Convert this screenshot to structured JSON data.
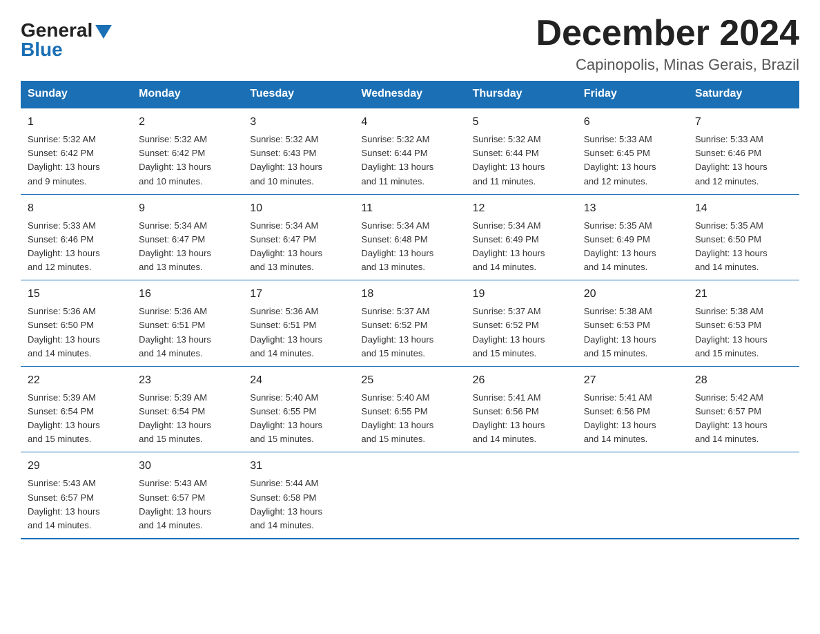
{
  "logo": {
    "general": "General",
    "blue": "Blue"
  },
  "title": "December 2024",
  "subtitle": "Capinopolis, Minas Gerais, Brazil",
  "days_of_week": [
    "Sunday",
    "Monday",
    "Tuesday",
    "Wednesday",
    "Thursday",
    "Friday",
    "Saturday"
  ],
  "weeks": [
    [
      {
        "day": "1",
        "sunrise": "5:32 AM",
        "sunset": "6:42 PM",
        "daylight": "13 hours and 9 minutes."
      },
      {
        "day": "2",
        "sunrise": "5:32 AM",
        "sunset": "6:42 PM",
        "daylight": "13 hours and 10 minutes."
      },
      {
        "day": "3",
        "sunrise": "5:32 AM",
        "sunset": "6:43 PM",
        "daylight": "13 hours and 10 minutes."
      },
      {
        "day": "4",
        "sunrise": "5:32 AM",
        "sunset": "6:44 PM",
        "daylight": "13 hours and 11 minutes."
      },
      {
        "day": "5",
        "sunrise": "5:32 AM",
        "sunset": "6:44 PM",
        "daylight": "13 hours and 11 minutes."
      },
      {
        "day": "6",
        "sunrise": "5:33 AM",
        "sunset": "6:45 PM",
        "daylight": "13 hours and 12 minutes."
      },
      {
        "day": "7",
        "sunrise": "5:33 AM",
        "sunset": "6:46 PM",
        "daylight": "13 hours and 12 minutes."
      }
    ],
    [
      {
        "day": "8",
        "sunrise": "5:33 AM",
        "sunset": "6:46 PM",
        "daylight": "13 hours and 12 minutes."
      },
      {
        "day": "9",
        "sunrise": "5:34 AM",
        "sunset": "6:47 PM",
        "daylight": "13 hours and 13 minutes."
      },
      {
        "day": "10",
        "sunrise": "5:34 AM",
        "sunset": "6:47 PM",
        "daylight": "13 hours and 13 minutes."
      },
      {
        "day": "11",
        "sunrise": "5:34 AM",
        "sunset": "6:48 PM",
        "daylight": "13 hours and 13 minutes."
      },
      {
        "day": "12",
        "sunrise": "5:34 AM",
        "sunset": "6:49 PM",
        "daylight": "13 hours and 14 minutes."
      },
      {
        "day": "13",
        "sunrise": "5:35 AM",
        "sunset": "6:49 PM",
        "daylight": "13 hours and 14 minutes."
      },
      {
        "day": "14",
        "sunrise": "5:35 AM",
        "sunset": "6:50 PM",
        "daylight": "13 hours and 14 minutes."
      }
    ],
    [
      {
        "day": "15",
        "sunrise": "5:36 AM",
        "sunset": "6:50 PM",
        "daylight": "13 hours and 14 minutes."
      },
      {
        "day": "16",
        "sunrise": "5:36 AM",
        "sunset": "6:51 PM",
        "daylight": "13 hours and 14 minutes."
      },
      {
        "day": "17",
        "sunrise": "5:36 AM",
        "sunset": "6:51 PM",
        "daylight": "13 hours and 14 minutes."
      },
      {
        "day": "18",
        "sunrise": "5:37 AM",
        "sunset": "6:52 PM",
        "daylight": "13 hours and 15 minutes."
      },
      {
        "day": "19",
        "sunrise": "5:37 AM",
        "sunset": "6:52 PM",
        "daylight": "13 hours and 15 minutes."
      },
      {
        "day": "20",
        "sunrise": "5:38 AM",
        "sunset": "6:53 PM",
        "daylight": "13 hours and 15 minutes."
      },
      {
        "day": "21",
        "sunrise": "5:38 AM",
        "sunset": "6:53 PM",
        "daylight": "13 hours and 15 minutes."
      }
    ],
    [
      {
        "day": "22",
        "sunrise": "5:39 AM",
        "sunset": "6:54 PM",
        "daylight": "13 hours and 15 minutes."
      },
      {
        "day": "23",
        "sunrise": "5:39 AM",
        "sunset": "6:54 PM",
        "daylight": "13 hours and 15 minutes."
      },
      {
        "day": "24",
        "sunrise": "5:40 AM",
        "sunset": "6:55 PM",
        "daylight": "13 hours and 15 minutes."
      },
      {
        "day": "25",
        "sunrise": "5:40 AM",
        "sunset": "6:55 PM",
        "daylight": "13 hours and 15 minutes."
      },
      {
        "day": "26",
        "sunrise": "5:41 AM",
        "sunset": "6:56 PM",
        "daylight": "13 hours and 14 minutes."
      },
      {
        "day": "27",
        "sunrise": "5:41 AM",
        "sunset": "6:56 PM",
        "daylight": "13 hours and 14 minutes."
      },
      {
        "day": "28",
        "sunrise": "5:42 AM",
        "sunset": "6:57 PM",
        "daylight": "13 hours and 14 minutes."
      }
    ],
    [
      {
        "day": "29",
        "sunrise": "5:43 AM",
        "sunset": "6:57 PM",
        "daylight": "13 hours and 14 minutes."
      },
      {
        "day": "30",
        "sunrise": "5:43 AM",
        "sunset": "6:57 PM",
        "daylight": "13 hours and 14 minutes."
      },
      {
        "day": "31",
        "sunrise": "5:44 AM",
        "sunset": "6:58 PM",
        "daylight": "13 hours and 14 minutes."
      },
      null,
      null,
      null,
      null
    ]
  ],
  "labels": {
    "sunrise": "Sunrise:",
    "sunset": "Sunset:",
    "daylight": "Daylight:"
  }
}
